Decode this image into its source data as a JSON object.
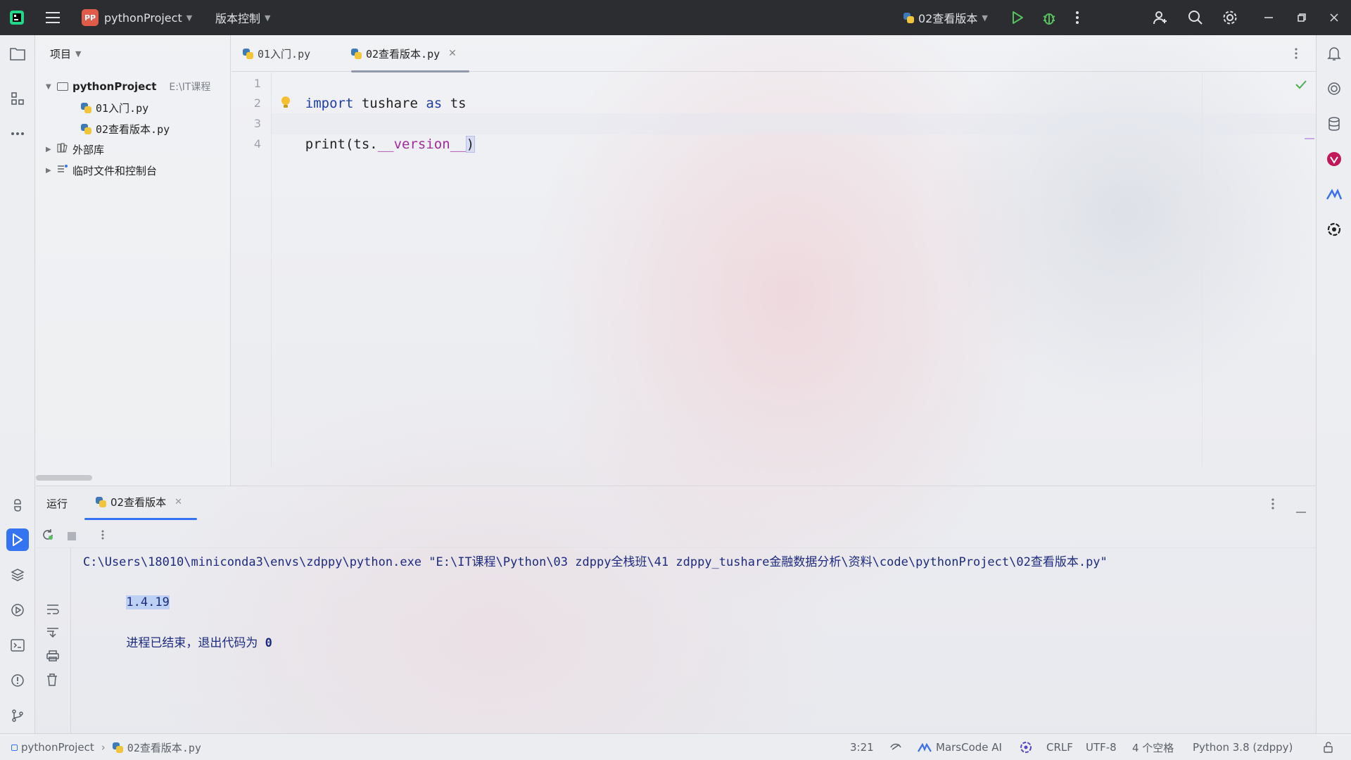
{
  "titlebar": {
    "project_badge": "PP",
    "project_name": "pythonProject",
    "vcs_menu": "版本控制",
    "run_config": "02查看版本"
  },
  "project_panel": {
    "header": "项目",
    "root_name": "pythonProject",
    "root_path": "E:\\IT课程",
    "files": [
      "01入门.py",
      "02查看版本.py"
    ],
    "external_libs": "外部库",
    "scratches": "临时文件和控制台"
  },
  "editor": {
    "tabs": [
      {
        "label": "01入门.py",
        "active": false
      },
      {
        "label": "02查看版本.py",
        "active": true
      }
    ],
    "line_numbers": [
      "1",
      "2",
      "3",
      "4"
    ],
    "code": {
      "line1_kw1": "import",
      "line1_mod": " tushare ",
      "line1_kw2": "as",
      "line1_alias": " ts",
      "line3_fn": "print(ts.",
      "line3_dunder": "__version__",
      "line3_end": ")"
    }
  },
  "run_panel": {
    "title": "运行",
    "tab_label": "02查看版本",
    "command": "C:\\Users\\18010\\miniconda3\\envs\\zdppy\\python.exe \"E:\\IT课程\\Python\\03 zdppy全栈班\\41 zdppy_tushare金融数据分析\\资料\\code\\pythonProject\\02查看版本.py\"",
    "output": "1.4.19",
    "exit_message": "进程已结束，退出代码为 ",
    "exit_code": "0"
  },
  "statusbar": {
    "project": "pythonProject",
    "file": "02查看版本.py",
    "cursor_position": "3:21",
    "ai_plugin": "MarsCode AI",
    "line_separator": "CRLF",
    "encoding": "UTF-8",
    "indent": "4 个空格",
    "interpreter": "Python 3.8 (zdppy)"
  },
  "colors": {
    "accent": "#3574f0",
    "titlebar_bg": "#2b2d30",
    "keyword": "#1f3ea8",
    "dunder": "#a3299f"
  }
}
